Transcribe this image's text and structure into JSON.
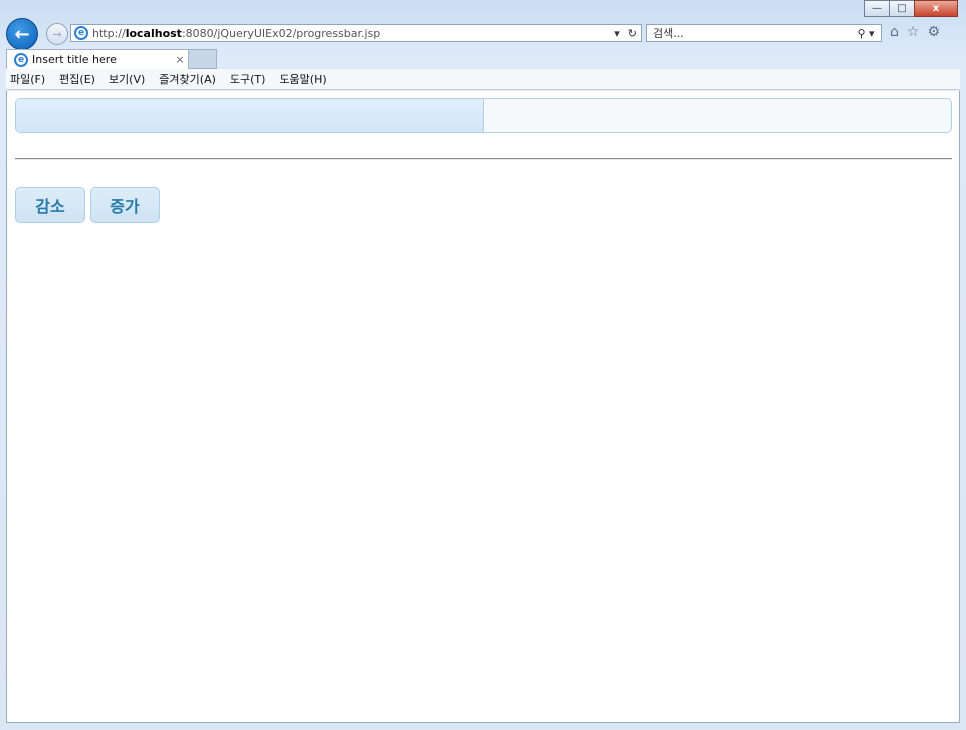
{
  "window": {
    "minimize": "—",
    "maximize": "□",
    "close": "x"
  },
  "nav": {
    "url_prefix": "http://",
    "url_host": "localhost",
    "url_rest": ":8080/jQueryUIEx02/progressbar.jsp",
    "search_placeholder": "검색..."
  },
  "tab": {
    "title": "Insert title here",
    "close": "×"
  },
  "menu": [
    "파일(F)",
    "편집(E)",
    "보기(V)",
    "즐겨찾기(A)",
    "도구(T)",
    "도움말(H)"
  ],
  "page": {
    "progress_fraction": 0.5,
    "decrease_label": "감소",
    "increase_label": "증가"
  },
  "colors": {
    "button_text": "#2779aa",
    "button_border": "#aed0ea",
    "progress_fill": "#d7e9f9"
  }
}
